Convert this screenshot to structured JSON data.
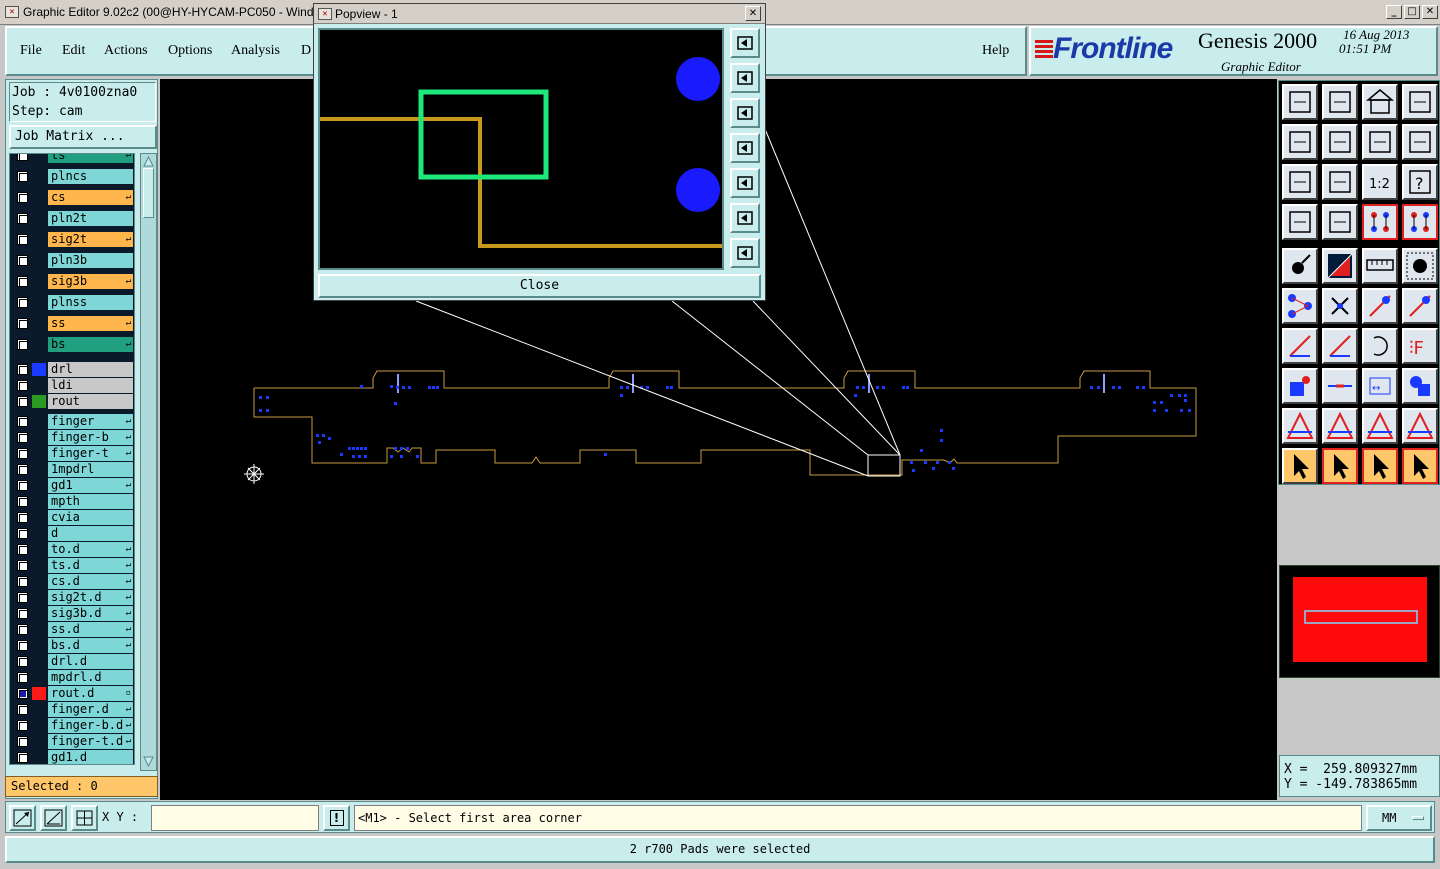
{
  "window": {
    "title": "Graphic Editor 9.02c2 (00@HY-HYCAM-PC050 - Wind",
    "min": "_",
    "max": "□",
    "close": "✕"
  },
  "menu": {
    "items": [
      "File",
      "Edit",
      "Actions",
      "Options",
      "Analysis",
      "D"
    ],
    "help": "Help"
  },
  "brand": {
    "logo": "Frontline",
    "product": "Genesis 2000",
    "subtitle": "Graphic Editor",
    "date": "16 Aug 2013",
    "time": "01:51 PM"
  },
  "job": {
    "job_line": "Job : 4v0100zna0",
    "step_line": "Step: cam",
    "matrix_button": "Job Matrix ..."
  },
  "layers": [
    {
      "name": "ts",
      "style": "green",
      "mark": "↵",
      "partial": true
    },
    {
      "name": "plncs",
      "style": "cyan",
      "mark": ""
    },
    {
      "name": "cs",
      "style": "orange",
      "mark": "↵"
    },
    {
      "name": "pln2t",
      "style": "cyan",
      "mark": ""
    },
    {
      "name": "sig2t",
      "style": "orange",
      "mark": "↵"
    },
    {
      "name": "pln3b",
      "style": "cyan",
      "mark": ""
    },
    {
      "name": "sig3b",
      "style": "orange",
      "mark": "↵"
    },
    {
      "name": "plnss",
      "style": "cyan",
      "mark": ""
    },
    {
      "name": "ss",
      "style": "orange",
      "mark": "↵"
    },
    {
      "name": "bs",
      "style": "green",
      "mark": "↵"
    },
    {
      "name": "drl",
      "style": "gray",
      "mark": "",
      "swatch": "#1a3aff"
    },
    {
      "name": "ldi",
      "style": "gray",
      "mark": ""
    },
    {
      "name": "rout",
      "style": "gray",
      "mark": "",
      "swatch": "#2a9a20"
    },
    {
      "name": "finger",
      "style": "cyan",
      "mark": "↵"
    },
    {
      "name": "finger-b",
      "style": "cyan",
      "mark": "↵"
    },
    {
      "name": "finger-t",
      "style": "cyan",
      "mark": "↵"
    },
    {
      "name": "1mpdrl",
      "style": "cyan",
      "mark": ""
    },
    {
      "name": "gd1",
      "style": "cyan",
      "mark": "↵"
    },
    {
      "name": "mpth",
      "style": "cyan",
      "mark": ""
    },
    {
      "name": "cvia",
      "style": "cyan",
      "mark": ""
    },
    {
      "name": "d",
      "style": "cyan",
      "mark": ""
    },
    {
      "name": "to.d",
      "style": "cyan",
      "mark": "↵"
    },
    {
      "name": "ts.d",
      "style": "cyan",
      "mark": "↵"
    },
    {
      "name": "cs.d",
      "style": "cyan",
      "mark": "↵"
    },
    {
      "name": "sig2t.d",
      "style": "cyan",
      "mark": "↵"
    },
    {
      "name": "sig3b.d",
      "style": "cyan",
      "mark": "↵"
    },
    {
      "name": "ss.d",
      "style": "cyan",
      "mark": "↵"
    },
    {
      "name": "bs.d",
      "style": "cyan",
      "mark": "↵"
    },
    {
      "name": "drl.d",
      "style": "cyan",
      "mark": ""
    },
    {
      "name": "mpdrl.d",
      "style": "cyan",
      "mark": ""
    },
    {
      "name": "rout.d",
      "style": "cyan",
      "mark": "▫",
      "swatch": "#ff1a1a",
      "checked": true
    },
    {
      "name": "finger.d",
      "style": "cyan",
      "mark": "↵"
    },
    {
      "name": "finger-b.d",
      "style": "cyan",
      "mark": "↵"
    },
    {
      "name": "finger-t.d",
      "style": "cyan",
      "mark": "↵"
    },
    {
      "name": "gd1.d",
      "style": "cyan",
      "mark": ""
    }
  ],
  "selected": "Selected : 0",
  "popview": {
    "title": "Popview - 1",
    "close_label": "Close",
    "close_x": "✕"
  },
  "coords": {
    "x": "X =  259.809327mm",
    "y": "Y = -149.783865mm"
  },
  "bottom": {
    "xy_label": "X Y :",
    "xy_value": "",
    "prompt": "<M1> - Select first area corner",
    "unit": "MM",
    "info_icon": "!"
  },
  "status": "2 r700 Pads were selected",
  "colors": {
    "panel": "#c9ecec",
    "accent_orange": "#ffc66a",
    "board_outline": "#c89a40",
    "pads": "#1a3aff",
    "highlight": "#1ee87a"
  }
}
